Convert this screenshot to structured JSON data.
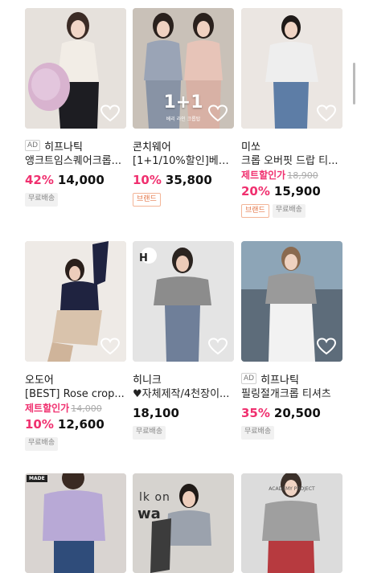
{
  "products": [
    {
      "id": "p1",
      "ad": "AD",
      "brand": "히프나틱",
      "name": "앵크트임스퀘어크롭...",
      "sale_label": "",
      "original_price": "",
      "discount": "42%",
      "price": "14,000",
      "badges": [
        {
          "text": "무료배송",
          "style": "gray"
        }
      ],
      "image": {
        "bg": "#e9e4df",
        "fig": "#f3ede6",
        "extra": "#d9b6d1",
        "overlay_big": "",
        "overlay_small": "",
        "tag": ""
      }
    },
    {
      "id": "p2",
      "ad": "",
      "brand": "콘치웨어",
      "name": "[1+1/10%할인]베리...",
      "sale_label": "",
      "original_price": "",
      "discount": "10%",
      "price": "35,800",
      "badges": [
        {
          "text": "브랜드",
          "style": "orange"
        }
      ],
      "image": {
        "bg": "#b5aea6",
        "fig": "#9aa4b6",
        "extra": "#e9c6bd",
        "overlay_big": "1+1",
        "overlay_small": "베리 라인 크롭탑",
        "tag": ""
      }
    },
    {
      "id": "p3",
      "ad": "",
      "brand": "미쏘",
      "name": "크롭 오버핏 드랍 티...",
      "sale_label": "제트할인가",
      "original_price": "18,900",
      "discount": "20%",
      "price": "15,900",
      "badges": [
        {
          "text": "브랜드",
          "style": "orange"
        },
        {
          "text": "무료배송",
          "style": "gray"
        }
      ],
      "image": {
        "bg": "#ebe7e3",
        "fig": "#ececec",
        "extra": "#5d7da6",
        "overlay_big": "",
        "overlay_small": "",
        "tag": ""
      }
    },
    {
      "id": "p4",
      "ad": "",
      "brand": "오도어",
      "name": "[BEST] Rose crop...",
      "sale_label": "제트할인가",
      "original_price": "14,000",
      "discount": "10%",
      "price": "12,600",
      "badges": [
        {
          "text": "무료배송",
          "style": "gray"
        }
      ],
      "image": {
        "bg": "#eeeae6",
        "fig": "#1f2340",
        "extra": "#d9c3ac",
        "overlay_big": "",
        "overlay_small": "",
        "tag": ""
      }
    },
    {
      "id": "p5",
      "ad": "",
      "brand": "히니크",
      "name": "♥자체제작/4천장이...",
      "sale_label": "",
      "original_price": "",
      "discount": "",
      "price": "18,100",
      "badges": [
        {
          "text": "무료배송",
          "style": "gray"
        }
      ],
      "image": {
        "bg": "#e6e6e6",
        "fig": "#8c8c8c",
        "extra": "#6f7f99",
        "overlay_big": "",
        "overlay_small": "",
        "tag": "H"
      }
    },
    {
      "id": "p6",
      "ad": "AD",
      "brand": "히프나틱",
      "name": "필링절개크롭 티셔츠",
      "sale_label": "",
      "original_price": "",
      "discount": "35%",
      "price": "20,500",
      "badges": [
        {
          "text": "무료배송",
          "style": "gray"
        }
      ],
      "image": {
        "bg": "#8da5b7",
        "fig": "#9a9a9a",
        "extra": "#f2f2f2",
        "overlay_big": "",
        "overlay_small": "",
        "tag": ""
      }
    },
    {
      "id": "p7",
      "ad": "",
      "brand": "",
      "name": "",
      "sale_label": "",
      "original_price": "",
      "discount": "",
      "price": "",
      "badges": [],
      "image": {
        "bg": "#d9d4d1",
        "fig": "#b8a9d6",
        "extra": "#2f4c7a",
        "overlay_big": "",
        "overlay_small": "",
        "tag": "MADE"
      }
    },
    {
      "id": "p8",
      "ad": "",
      "brand": "",
      "name": "",
      "sale_label": "",
      "original_price": "",
      "discount": "",
      "price": "",
      "badges": [],
      "image": {
        "bg": "#d6d3cf",
        "fig": "#3c3c3c",
        "extra": "#9ba2ad",
        "overlay_big": "",
        "overlay_small": "",
        "tag": "",
        "img_text": "lk on",
        "img_text2": "wa"
      }
    },
    {
      "id": "p9",
      "ad": "",
      "brand": "",
      "name": "",
      "sale_label": "",
      "original_price": "",
      "discount": "",
      "price": "",
      "badges": [],
      "image": {
        "bg": "#dcdcdc",
        "fig": "#9f9f9f",
        "extra": "#b73a3f",
        "overlay_big": "",
        "overlay_small": "",
        "tag": "",
        "img_text3": "ACADEMY PROJECT"
      }
    }
  ],
  "icons": {
    "heart": "heart-outline-icon"
  },
  "colors": {
    "accent": "#f0306f",
    "text": "#111111",
    "muted": "#888888",
    "brand_badge": "#e4794c"
  }
}
